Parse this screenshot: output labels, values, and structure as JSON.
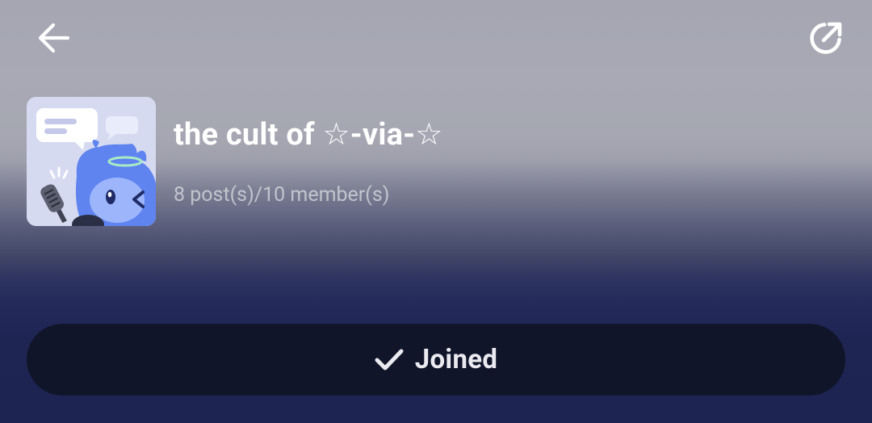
{
  "header": {
    "back_icon": "arrow-left-icon",
    "share_icon": "share-external-icon"
  },
  "group": {
    "name": "the cult of ☆-via-☆",
    "stats": "8 post(s)/10 member(s)",
    "avatar_icon": "mascot-chat-bubble-avatar"
  },
  "action": {
    "joined_label": "Joined",
    "joined_icon": "checkmark-icon"
  },
  "colors": {
    "button_bg": "#11152a",
    "accent_blue": "#5f84f0",
    "text_primary": "#ffffff"
  }
}
